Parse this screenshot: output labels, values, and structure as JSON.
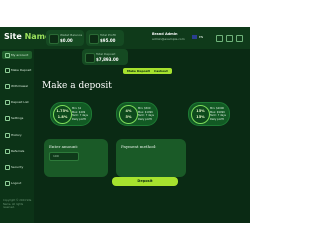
{
  "header": {
    "logo_site": "Site",
    "logo_name": "Name",
    "balances": [
      {
        "label": "Wallet Balance",
        "value": "$0.00"
      },
      {
        "label": "Total Profit",
        "value": "$95.00"
      },
      {
        "label": "Total Deposit",
        "value": "$7,893.00"
      }
    ],
    "make_deposit_label": "Make Deposit",
    "cashout_label": "Cashout",
    "user": {
      "name": "Brand Admin",
      "email": "admin@example.com"
    },
    "language": "EN"
  },
  "sidebar": {
    "items": [
      {
        "label": "My account"
      },
      {
        "label": "Make Deposit"
      },
      {
        "label": "Withdrawal"
      },
      {
        "label": "Deposit List"
      },
      {
        "label": "Settings"
      },
      {
        "label": "History"
      },
      {
        "label": "Referrals"
      },
      {
        "label": "Security"
      },
      {
        "label": "Logout"
      }
    ],
    "copyright": "Copyright © 2024 Site Name. All rights reserved."
  },
  "main": {
    "title": "Make a deposit",
    "plans": [
      {
        "pct1": "1.75%",
        "pct2": "1.8%",
        "info1": "Min: $1",
        "info2": "Max: $499",
        "info3": "Term: 7 days",
        "info4": "Daily profit"
      },
      {
        "pct1": "4%",
        "pct2": "5%",
        "info1": "Min: $500",
        "info2": "Max: $1999",
        "info3": "Term: 7 days",
        "info4": "Daily profit"
      },
      {
        "pct1": "15%",
        "pct2": "15%",
        "info1": "Min: $2000",
        "info2": "Max: $9999",
        "info3": "Term: 7 days",
        "info4": "Daily profit"
      }
    ],
    "amount": {
      "label": "Enter amount:",
      "placeholder": "100"
    },
    "payment": {
      "label": "Payment method:"
    },
    "deposit_button": "Deposit"
  }
}
